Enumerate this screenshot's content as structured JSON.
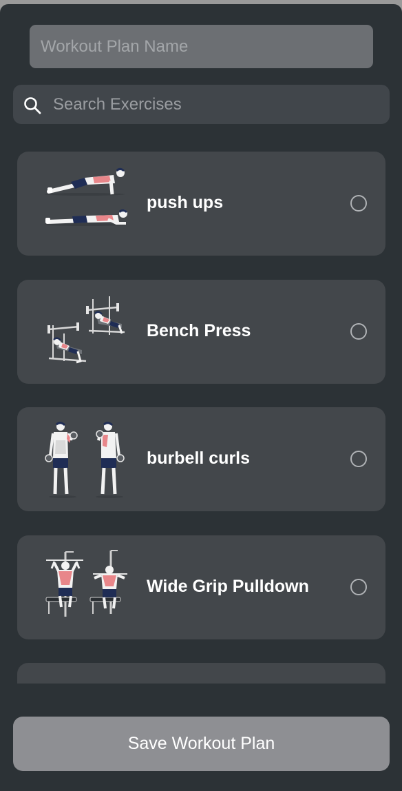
{
  "form": {
    "plan_name_placeholder": "Workout Plan Name",
    "search_placeholder": "Search Exercises"
  },
  "exercises": [
    {
      "name": "push ups",
      "selected": false
    },
    {
      "name": "Bench Press",
      "selected": false
    },
    {
      "name": "burbell curls",
      "selected": false
    },
    {
      "name": "Wide Grip Pulldown",
      "selected": false
    }
  ],
  "save_button": {
    "label": "Save Workout Plan"
  },
  "colors": {
    "background": "#2c3236",
    "card": "#43474b",
    "input": "#6c6f73",
    "button": "#8e8f93",
    "muscle_highlight": "#e8868a",
    "shorts": "#1f2d55"
  },
  "icons": {
    "search": "search-icon",
    "radio": "radio-unchecked-icon"
  }
}
